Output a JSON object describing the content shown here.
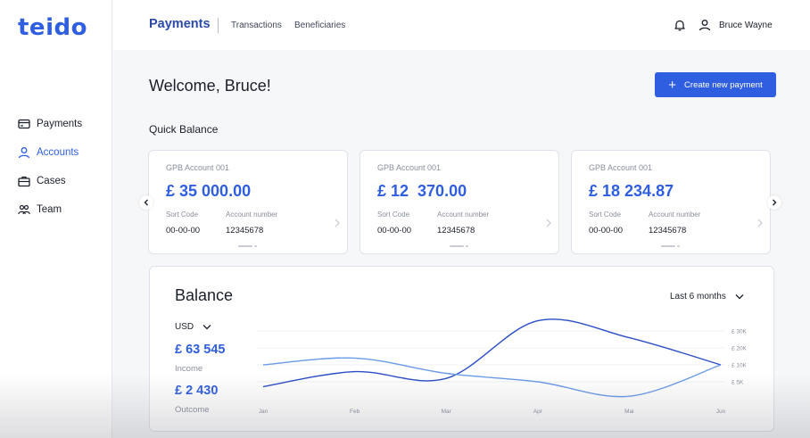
{
  "app": {
    "logo": "teido"
  },
  "sidebar": {
    "items": [
      {
        "label": "Payments",
        "icon": "credit-card-icon",
        "active": false
      },
      {
        "label": "Accounts",
        "icon": "user-icon",
        "active": true
      },
      {
        "label": "Cases",
        "icon": "briefcase-icon",
        "active": false
      },
      {
        "label": "Team",
        "icon": "team-icon",
        "active": false
      }
    ]
  },
  "header": {
    "tabs": [
      {
        "label": "Payments",
        "active": true
      },
      {
        "label": "Transactions",
        "active": false
      },
      {
        "label": "Beneficiaries",
        "active": false
      }
    ],
    "user_name": "Bruce Wayne",
    "icons": [
      "bell-icon",
      "user-icon"
    ]
  },
  "main": {
    "welcome": "Welcome, Bruce!",
    "create_button": "Create new payment",
    "quick_balance_title": "Quick Balance",
    "accounts": [
      {
        "name": "GPB Account 001",
        "amount": "£ 35 000.00",
        "sort_code_label": "Sort Code",
        "account_number_label": "Account number",
        "sort_code": "00-00-00",
        "account_number": "12345678"
      },
      {
        "name": "GPB Account 001",
        "amount": "£ 12  370.00",
        "sort_code_label": "Sort Code",
        "account_number_label": "Account number",
        "sort_code": "00-00-00",
        "account_number": "12345678"
      },
      {
        "name": "GPB Account 001",
        "amount": "£ 18 234.87",
        "sort_code_label": "Sort Code",
        "account_number_label": "Account number",
        "sort_code": "00-00-00",
        "account_number": "12345678"
      }
    ]
  },
  "balance": {
    "title": "Balance",
    "period": "Last 6 months",
    "currency": "USD",
    "income_value": "£ 63 545",
    "income_label": "Income",
    "outcome_value": "£ 2 430",
    "outcome_label": "Outcome"
  },
  "colors": {
    "accent": "#2f5ee0",
    "income_line": "#2b4ec4",
    "outcome_line": "#6a9ae8"
  },
  "chart_data": {
    "type": "line",
    "x": [
      "Jan",
      "Feb",
      "Mar",
      "Apr",
      "Mai",
      "Jun"
    ],
    "y_ticks": [
      "£ 5K",
      "£ 10K",
      "£ 20K",
      "£ 30K"
    ],
    "series": [
      {
        "values": [
          3500,
          8000,
          6000,
          36000,
          26000,
          10000
        ]
      },
      {
        "values": [
          10000,
          14000,
          7500,
          5000,
          500,
          10000
        ]
      }
    ]
  }
}
